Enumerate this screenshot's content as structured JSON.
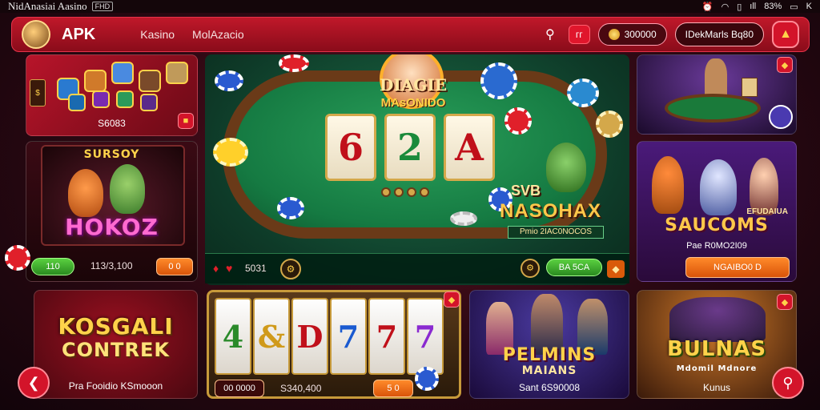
{
  "status_bar": {
    "app_title": "NidAnasiai Aasino",
    "badge": "FHD",
    "signal": "ıll",
    "battery": "83%",
    "extra": "K"
  },
  "header": {
    "brand": "APK",
    "nav": [
      "Kasino",
      "MolAzacio"
    ],
    "red_pill": "ᴦᴦ",
    "coins": "300000",
    "user": "IDekMarls Bq80"
  },
  "cards": {
    "top_left": {
      "caption": "S6083"
    },
    "left_mid": {
      "title_top": "SURSOY",
      "title_main": "HOKOZ",
      "chip": "110",
      "value": "113/3,100",
      "button": "0 0"
    },
    "center": {
      "logo_top": "DIAGIE",
      "logo_main": "MAsONIDO",
      "cards": [
        "6",
        "2",
        "A"
      ],
      "brand_top": "SVB",
      "brand_main": "NASOHAX",
      "sub": "Pmio 2IAC0NOCOS",
      "value_left": "5031",
      "button": "BA 5CA"
    },
    "top_right": {},
    "right_mid": {
      "title_top": "EFUDAIUA",
      "title_main": "SAUCOMS",
      "sub": "Pae R0MO2I09",
      "button": "NGAIBO0 D"
    },
    "bottom_left": {
      "title_main": "KOSGALI",
      "title_sub": "CONTREK",
      "caption": "Pra Fooidio KSmooon"
    },
    "bottom_slot": {
      "reels": [
        "4",
        "&",
        "D",
        "7",
        "7",
        "7"
      ],
      "chip_label": "00 0000",
      "value": "S340,400",
      "button": "5 0"
    },
    "bottom_center_right": {
      "title": "PELMINS",
      "subtitle": "MAIANS",
      "caption": "Sant 6S90008"
    },
    "bottom_right": {
      "title": "BULNAS",
      "sub": "Mdomil Mdnore",
      "caption": "Kunus"
    }
  },
  "colors": {
    "accent": "#d3142a",
    "felt": "#157a42",
    "gold": "#d4a84a"
  }
}
